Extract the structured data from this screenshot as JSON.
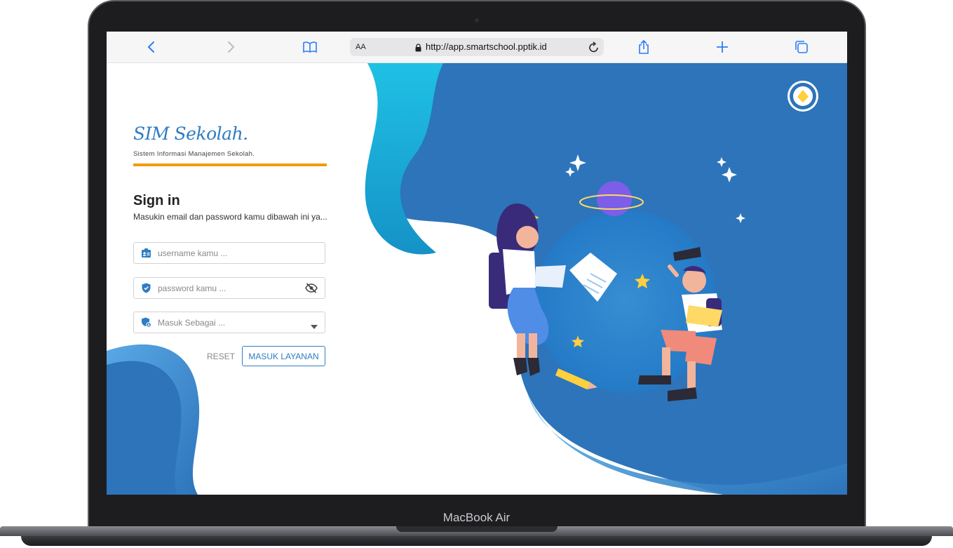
{
  "device": {
    "label": "MacBook Air"
  },
  "browser": {
    "text_size_label": "AA",
    "url": "http://app.smartschool.pptik.id",
    "buttons": {
      "back": "back-icon",
      "forward": "forward-icon",
      "bookmarks": "book-icon",
      "reload": "reload-icon",
      "share": "share-icon",
      "new_tab": "plus-icon",
      "tabs": "tabs-icon"
    }
  },
  "app": {
    "logo": "SIM Sekolah.",
    "tagline": "Sistem Informasi Manajemen Sekolah.",
    "colors": {
      "accent": "#2f7cc2",
      "rule": "#f39a0b",
      "hero_bg": "#2d74bb"
    }
  },
  "signin": {
    "title": "Sign in",
    "subtitle": "Masukin email dan password kamu dibawah ini ya...",
    "username_placeholder": "username kamu ...",
    "password_placeholder": "password kamu ...",
    "role_placeholder": "Masuk Sebagai ...",
    "reset_label": "RESET",
    "submit_label": "MASUK LAYANAN"
  }
}
